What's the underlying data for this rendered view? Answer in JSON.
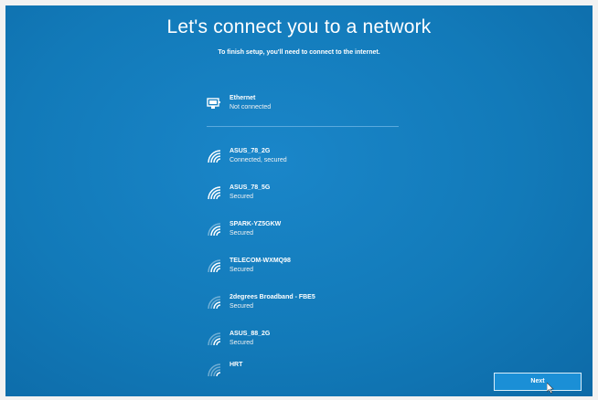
{
  "header": {
    "title": "Let's connect you to a network",
    "subtitle": "To finish setup, you'll need to connect to the internet."
  },
  "ethernet": {
    "name": "Ethernet",
    "status": "Not connected",
    "icon": "ethernet-icon"
  },
  "networks": [
    {
      "name": "ASUS_78_2G",
      "status": "Connected, secured",
      "icon": "wifi-icon"
    },
    {
      "name": "ASUS_78_5G",
      "status": "Secured",
      "icon": "wifi-icon"
    },
    {
      "name": "SPARK-YZ5GKW",
      "status": "Secured",
      "icon": "wifi-icon"
    },
    {
      "name": "TELECOM-WXMQ98",
      "status": "Secured",
      "icon": "wifi-icon"
    },
    {
      "name": "2degrees Broadband - FBE5",
      "status": "Secured",
      "icon": "wifi-icon"
    },
    {
      "name": "ASUS_88_2G",
      "status": "Secured",
      "icon": "wifi-icon"
    },
    {
      "name": "HRT",
      "status": "",
      "icon": "wifi-icon"
    }
  ],
  "footer": {
    "next_label": "Next"
  },
  "colors": {
    "background": "#127ab9",
    "button": "#1b8fd6",
    "text": "#ffffff"
  }
}
